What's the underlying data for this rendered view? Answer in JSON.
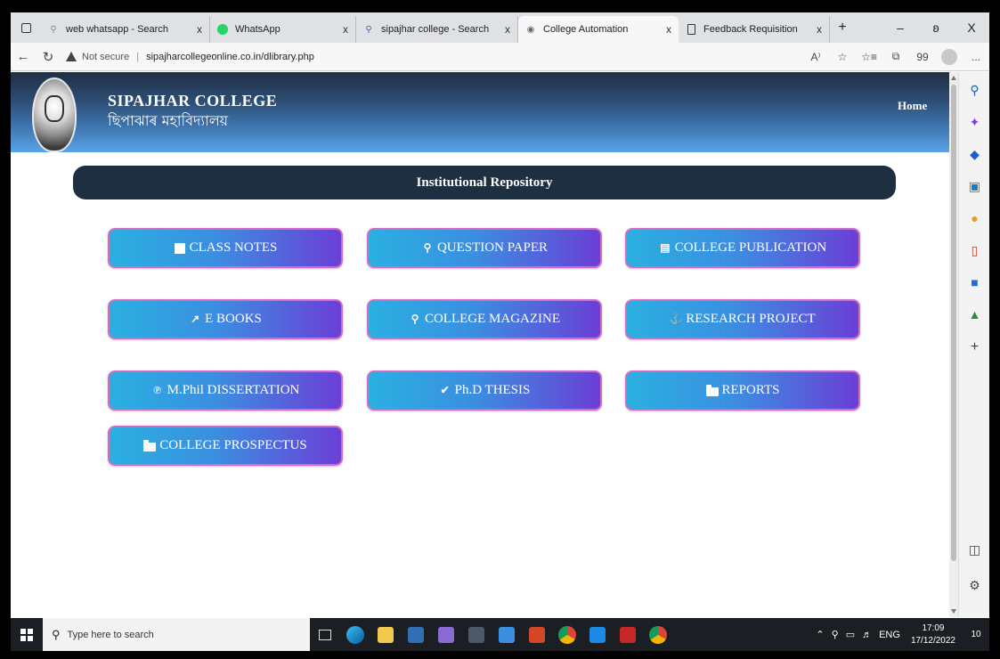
{
  "browser": {
    "tabs": [
      {
        "label": "web whatsapp - Search",
        "icon": "search-icon"
      },
      {
        "label": "WhatsApp",
        "icon": "whatsapp-icon"
      },
      {
        "label": "sipajhar college - Search",
        "icon": "search-icon"
      },
      {
        "label": "College Automation",
        "icon": "globe-icon",
        "active": true
      },
      {
        "label": "Feedback Requisition",
        "icon": "document-icon"
      }
    ],
    "new_tab": "+",
    "close_glyph": "x",
    "controls": {
      "minimize": "–",
      "restore": "ʚ",
      "close": "X"
    },
    "address": {
      "security": "Not secure",
      "separator": "|",
      "url": "sipajharcollegeonline.co.in/dlibrary.php"
    },
    "right_icons": {
      "read_aloud": "A⁾",
      "favorites_add": "☆",
      "favorites": "☆≡",
      "collections": "⧉",
      "quote": "99",
      "more": "..."
    }
  },
  "site": {
    "name": "SIPAJHAR COLLEGE",
    "native_name": "ছিপাঝাৰ মহাবিদ্যালয়",
    "nav_home": "Home",
    "section_title": "Institutional Repository",
    "buttons": [
      {
        "label": "CLASS NOTES",
        "icon": "book-icon"
      },
      {
        "label": "QUESTION PAPER",
        "icon": "search-icon"
      },
      {
        "label": "COLLEGE PUBLICATION",
        "icon": "bar-chart-icon"
      },
      {
        "label": "E BOOKS",
        "icon": "line-chart-icon"
      },
      {
        "label": "COLLEGE MAGAZINE",
        "icon": "search-icon"
      },
      {
        "label": "RESEARCH PROJECT",
        "icon": "anchor-icon"
      },
      {
        "label": "M.Phil DISSERTATION",
        "icon": "rss-icon"
      },
      {
        "label": "Ph.D THESIS",
        "icon": "check-icon"
      },
      {
        "label": "REPORTS",
        "icon": "folder-icon"
      },
      {
        "label": "COLLEGE PROSPECTUS",
        "icon": "folder-icon"
      }
    ]
  },
  "taskbar": {
    "search_placeholder": "Type here to search",
    "tray_language": "ENG",
    "time": "17:09",
    "date": "17/12/2022",
    "notifications": "10"
  },
  "colors": {
    "header_top": "#1f2f44",
    "header_bottom": "#5aa3e8",
    "repo_bar": "#1d2f40",
    "button_start": "#2ab0e0",
    "button_end": "#6a3fd6",
    "button_border": "#d46cc0"
  }
}
